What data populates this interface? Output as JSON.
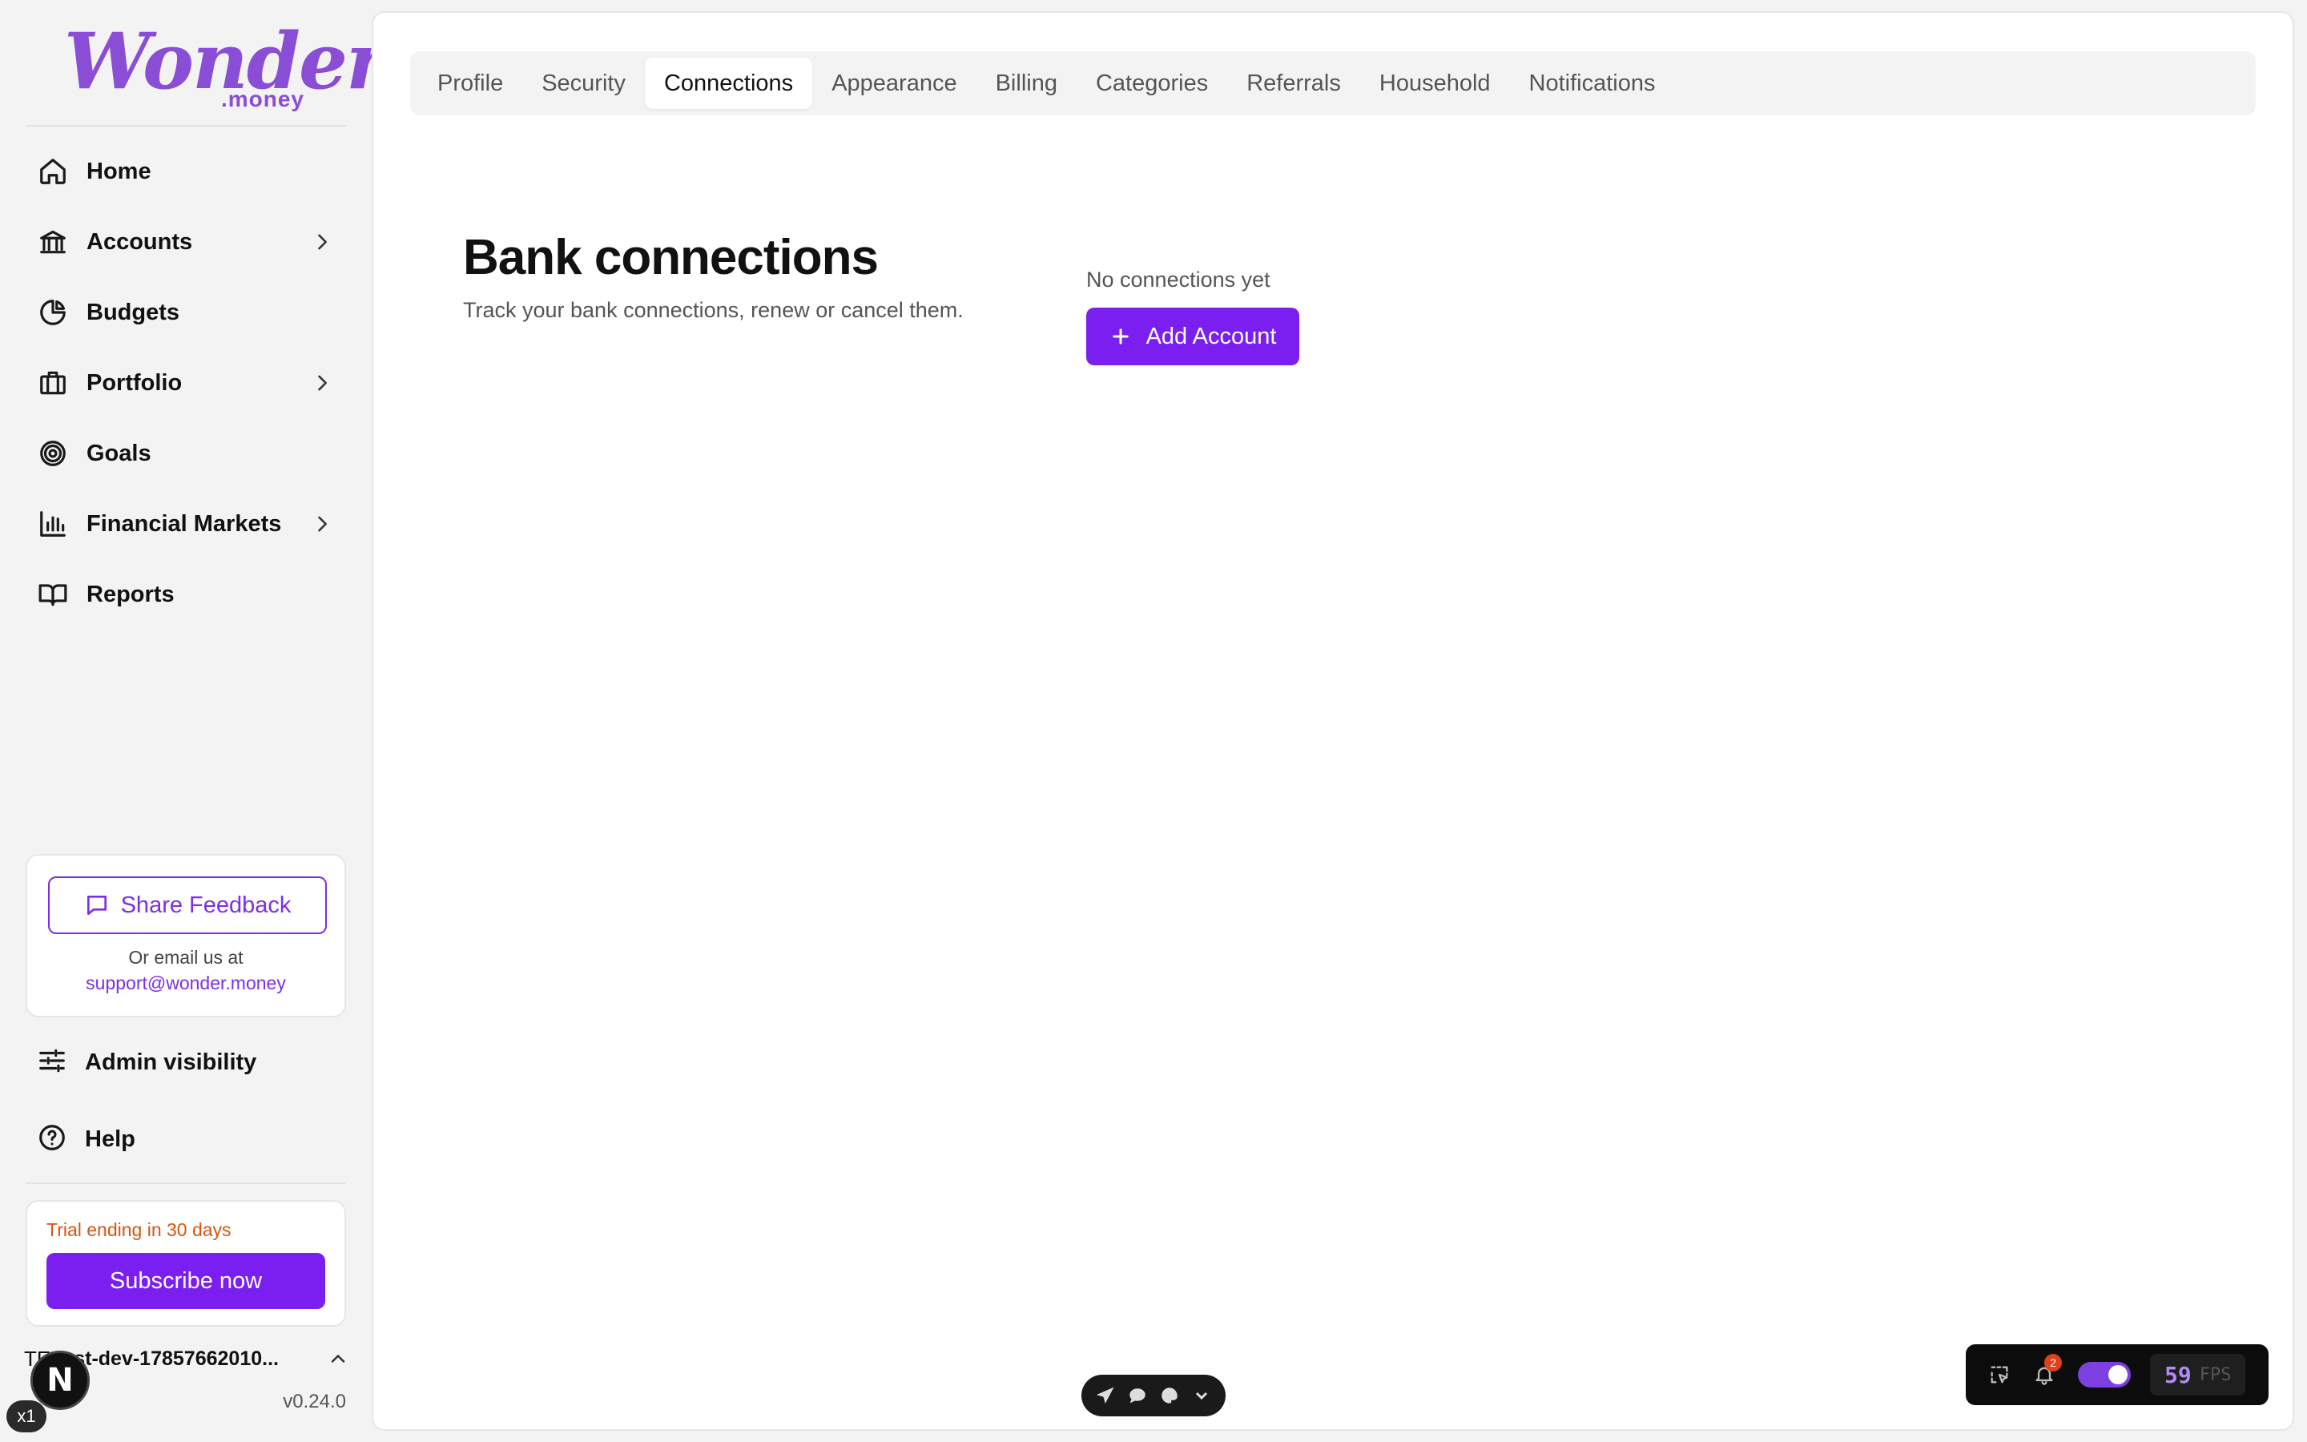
{
  "brand": {
    "name": "Wonder",
    "suffix": ".money",
    "color": "#8a4dd6"
  },
  "sidebar": {
    "nav": [
      {
        "label": "Home",
        "icon": "home-icon"
      },
      {
        "label": "Accounts",
        "icon": "bank-icon",
        "has_children": true
      },
      {
        "label": "Budgets",
        "icon": "pie-chart-icon"
      },
      {
        "label": "Portfolio",
        "icon": "briefcase-icon",
        "has_children": true
      },
      {
        "label": "Goals",
        "icon": "target-icon"
      },
      {
        "label": "Financial Markets",
        "icon": "bar-chart-icon",
        "has_children": true
      },
      {
        "label": "Reports",
        "icon": "book-icon"
      }
    ],
    "feedback": {
      "button_label": "Share Feedback",
      "or_text": "Or email us at",
      "email": "support@wonder.money"
    },
    "admin_label": "Admin visibility",
    "help_label": "Help",
    "trial": {
      "text": "Trial ending in 30 days",
      "button_label": "Subscribe now"
    },
    "user": {
      "initials": "TE",
      "name": "test-dev-17857662010..."
    },
    "version": "v0.24.0"
  },
  "tabs": [
    {
      "label": "Profile",
      "active": false
    },
    {
      "label": "Security",
      "active": false
    },
    {
      "label": "Connections",
      "active": true
    },
    {
      "label": "Appearance",
      "active": false
    },
    {
      "label": "Billing",
      "active": false
    },
    {
      "label": "Categories",
      "active": false
    },
    {
      "label": "Referrals",
      "active": false
    },
    {
      "label": "Household",
      "active": false
    },
    {
      "label": "Notifications",
      "active": false
    }
  ],
  "connections": {
    "title": "Bank connections",
    "subtitle": "Track your bank connections, renew or cancel them.",
    "empty_text": "No connections yet",
    "add_button_label": "Add Account"
  },
  "dev_overlay": {
    "next_badge": "N",
    "zoom": "x1",
    "notifications_count": "2",
    "fps_value": "59",
    "fps_label": "FPS"
  },
  "colors": {
    "accent": "#7a1ff0",
    "trial_warning": "#d9540f"
  }
}
